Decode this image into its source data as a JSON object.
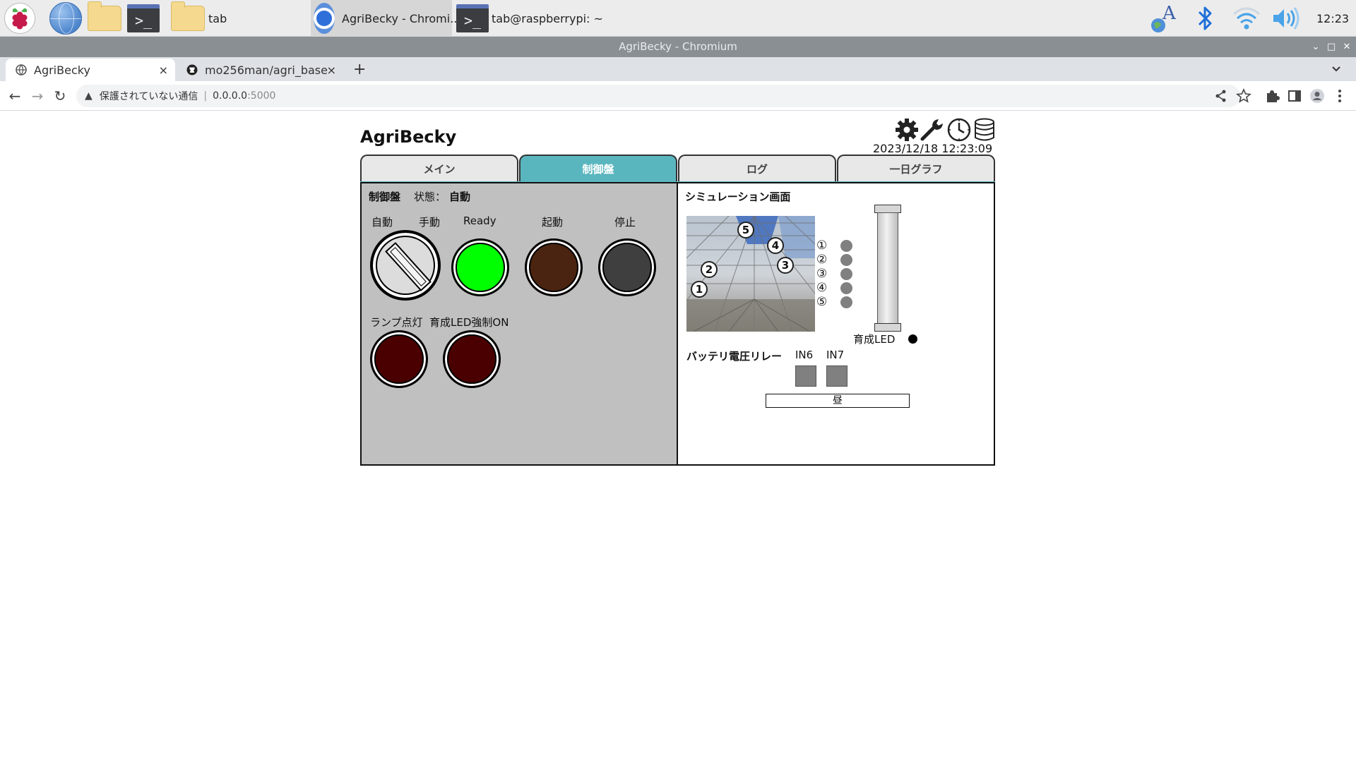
{
  "taskbar": {
    "folder_label": "tab",
    "chromium_label": "AgriBecky - Chromi...",
    "terminal_label": "tab@raspberrypi: ~",
    "clock": "12:23",
    "terminal_glyph": ">_"
  },
  "window": {
    "title": "AgriBecky - Chromium",
    "controls": [
      "⌄",
      "□",
      "✕"
    ]
  },
  "browser": {
    "tabs": [
      {
        "label": "AgriBecky",
        "close": "×"
      },
      {
        "label": "mo256man/agri_base",
        "close": "×"
      }
    ],
    "new_tab": "+",
    "address": {
      "warning": "▲",
      "security_text": "保護されていない通信",
      "separator": "|",
      "host": "0.0.0.0",
      "port": ":5000"
    },
    "nav": {
      "back": "←",
      "forward": "→",
      "reload": "↻"
    }
  },
  "app": {
    "title": "AgriBecky",
    "datetime": "2023/12/18 12:23:09",
    "header_icons": [
      "gear-icon",
      "wrench-icon",
      "clock-icon",
      "database-icon"
    ],
    "tabs": [
      {
        "label": "メイン",
        "active": false
      },
      {
        "label": "制御盤",
        "active": true
      },
      {
        "label": "ログ",
        "active": false
      },
      {
        "label": "一日グラフ",
        "active": false
      }
    ],
    "accent_color": "#5ab6be",
    "control_panel": {
      "title": "制御盤",
      "state_label": "状態：",
      "state_value": "自動",
      "selector_labels": {
        "auto": "自動",
        "manual": "手動"
      },
      "lamps": [
        {
          "label": "Ready",
          "color": "#00ff00"
        },
        {
          "label": "起動",
          "color": "#4a2410"
        },
        {
          "label": "停止",
          "color": "#3f3f3f"
        }
      ],
      "lower_labels": {
        "lamp_on": "ランプ点灯",
        "led_force_on": "育成LED強制ON"
      },
      "lower_lamps": [
        {
          "color": "#4a0000"
        },
        {
          "color": "#4a0000"
        }
      ]
    },
    "simulation": {
      "title": "シミュレーション画面",
      "photo_markers": [
        "1",
        "2",
        "3",
        "4",
        "5"
      ],
      "indicators": [
        {
          "label": "①",
          "color": "#808080"
        },
        {
          "label": "②",
          "color": "#808080"
        },
        {
          "label": "③",
          "color": "#808080"
        },
        {
          "label": "④",
          "color": "#808080"
        },
        {
          "label": "⑤",
          "color": "#808080"
        }
      ],
      "led_label": "育成LED",
      "battery_relay_label": "バッテリ電圧リレー",
      "relay_inputs": [
        {
          "label": "IN6",
          "color": "#808080"
        },
        {
          "label": "IN7",
          "color": "#808080"
        }
      ],
      "day_night": "昼"
    }
  }
}
